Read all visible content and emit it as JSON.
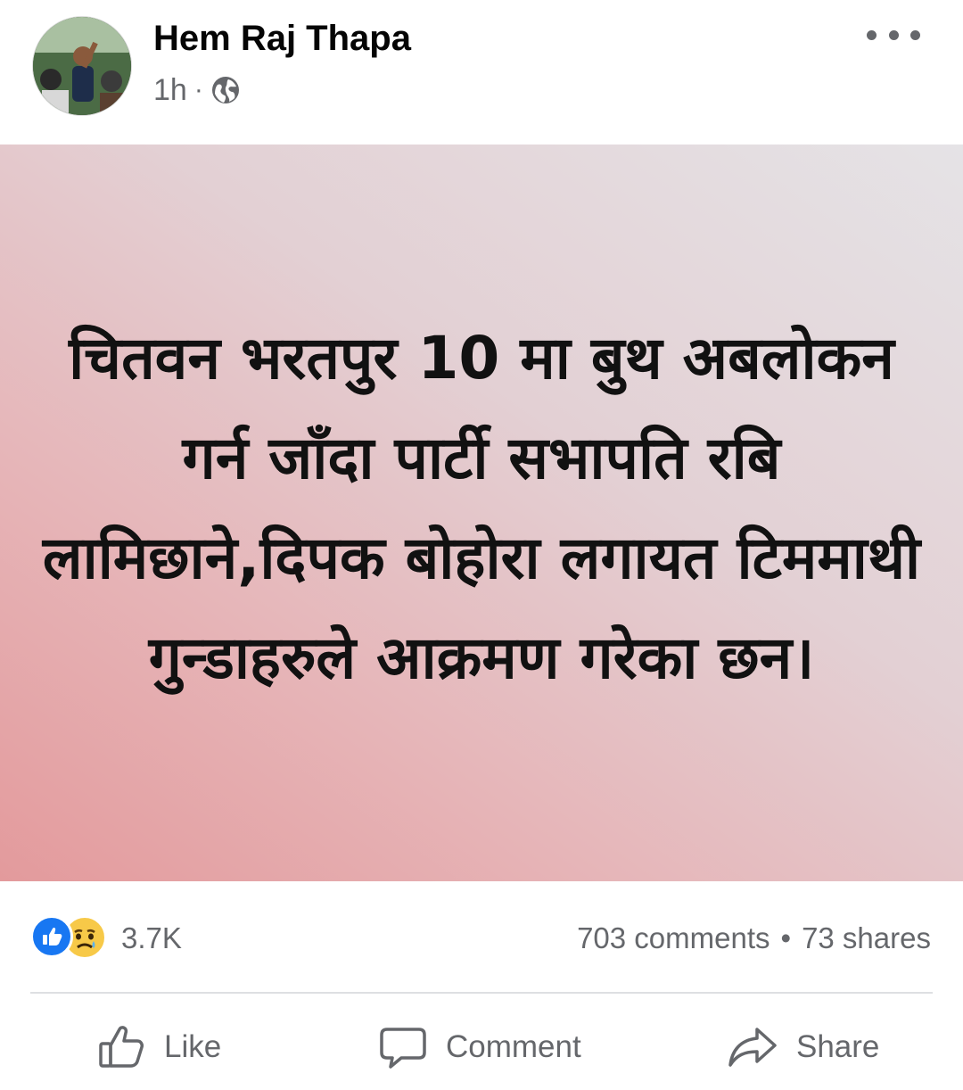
{
  "author": {
    "name": "Hem Raj Thapa",
    "time": "1h",
    "separator": "·",
    "privacy_icon": "globe-icon"
  },
  "more_icon": "more-horizontal-icon",
  "post": {
    "text": "चितवन भरतपुर 10 मा बुथ अबलोकन गर्न जाँदा पार्टी सभापति रबि लामिछाने,दिपक बोहोरा लगायत टिममाथी गुन्डाहरुले आक्रमण गरेका छन।",
    "background_colors": [
      "#e39a9c",
      "#e5e3e6"
    ]
  },
  "reactions": {
    "icons": [
      "like-reaction-icon",
      "sad-reaction-icon"
    ],
    "count": "3.7K"
  },
  "engagement": {
    "comments": "703 comments",
    "separator": "•",
    "shares": "73 shares"
  },
  "actions": {
    "like": "Like",
    "comment": "Comment",
    "share": "Share"
  },
  "colors": {
    "secondary_text": "#65676b",
    "facebook_blue": "#1877f2"
  }
}
